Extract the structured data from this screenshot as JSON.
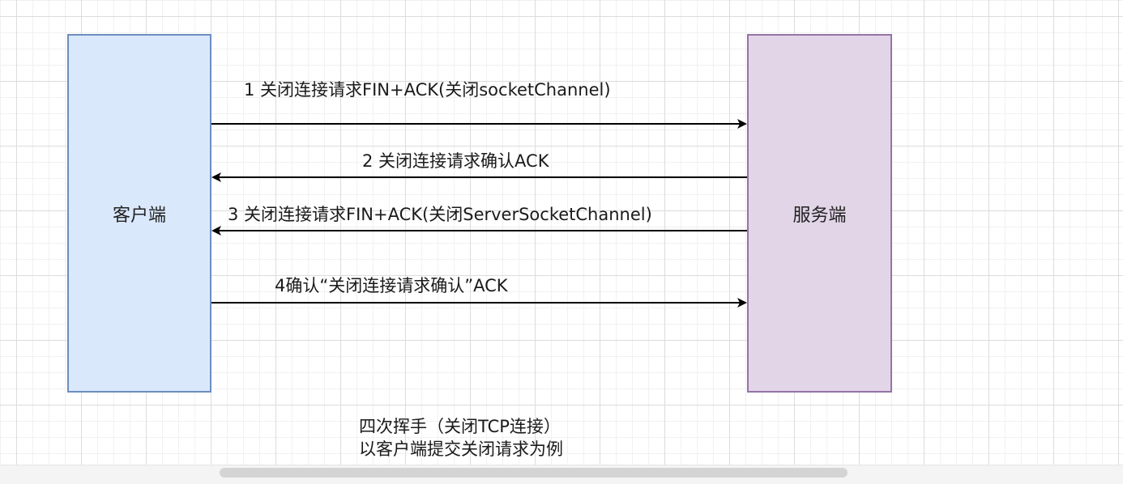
{
  "diagram": {
    "client_label": "客户端",
    "server_label": "服务端",
    "messages": [
      {
        "text": "1 关闭连接请求FIN+ACK(关闭socketChannel)",
        "direction": "client-to-server"
      },
      {
        "text": "2 关闭连接请求确认ACK",
        "direction": "server-to-client"
      },
      {
        "text": "3 关闭连接请求FIN+ACK(关闭ServerSocketChannel)",
        "direction": "server-to-client"
      },
      {
        "text": "4确认“关闭连接请求确认”ACK",
        "direction": "client-to-server"
      }
    ],
    "caption_line1": "四次挥手（关闭TCP连接）",
    "caption_line2": "以客户端提交关闭请求为例"
  },
  "colors": {
    "client_fill": "#dae8fc",
    "client_stroke": "#6c8ebf",
    "server_fill": "#e1d5e7",
    "server_stroke": "#9673a6",
    "arrow": "#000000"
  }
}
